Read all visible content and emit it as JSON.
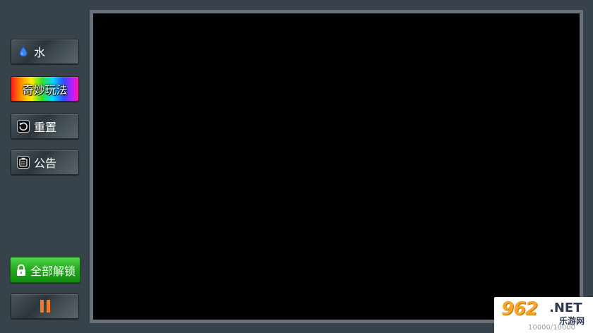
{
  "sidebar": {
    "water_label": "水",
    "magic_label": "奇妙玩法",
    "reset_label": "重置",
    "notice_label": "公告",
    "unlock_label": "全部解锁",
    "pause_icon": "pause-icon"
  },
  "colors": {
    "background": "#37424a",
    "canvas": "#000000",
    "canvas_border": "#68717a",
    "unlock_green": "#21a61c",
    "pause_orange": "#f07a2a",
    "water_blue": "#3b82f6"
  },
  "watermark": {
    "logo": "962",
    "net": ".NET",
    "sub": "乐游网",
    "counter": "10000/10000"
  }
}
